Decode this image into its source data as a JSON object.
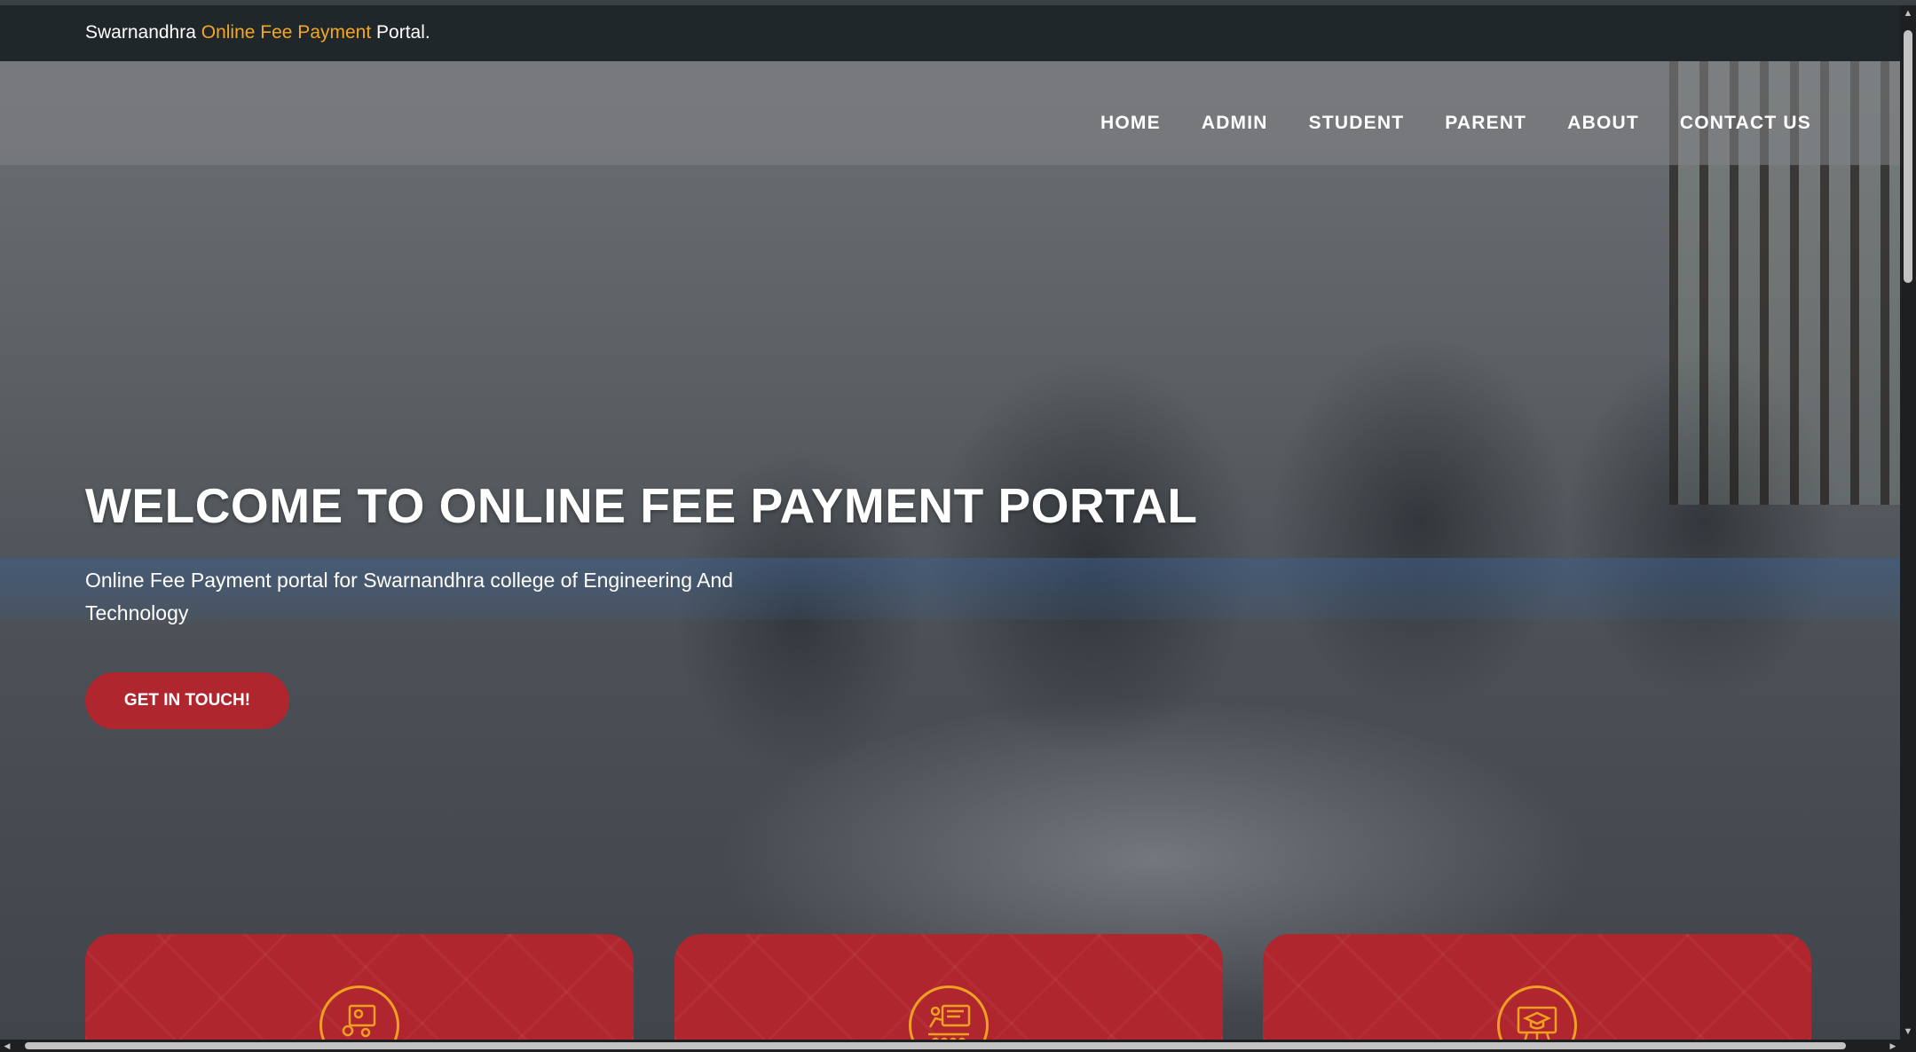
{
  "topbar": {
    "brand_prefix": "Swarnandhra ",
    "brand_accent": "Online Fee Payment",
    "brand_suffix": " Portal."
  },
  "nav": {
    "items": [
      {
        "label": "HOME"
      },
      {
        "label": "ADMIN"
      },
      {
        "label": "STUDENT"
      },
      {
        "label": "PARENT"
      },
      {
        "label": "ABOUT"
      },
      {
        "label": "CONTACT US"
      }
    ]
  },
  "hero": {
    "title": "WELCOME TO ONLINE FEE PAYMENT PORTAL",
    "subtitle": "Online Fee Payment portal for Swarnandhra college of Engineering And Technology",
    "cta_label": "GET IN TOUCH!"
  },
  "cards": [
    {
      "icon": "student-study-icon"
    },
    {
      "icon": "classroom-presentation-icon"
    },
    {
      "icon": "graduation-board-icon"
    }
  ],
  "colors": {
    "topbar_bg": "#1f272b",
    "accent_orange": "#f5a623",
    "brand_red": "#b0262f"
  }
}
